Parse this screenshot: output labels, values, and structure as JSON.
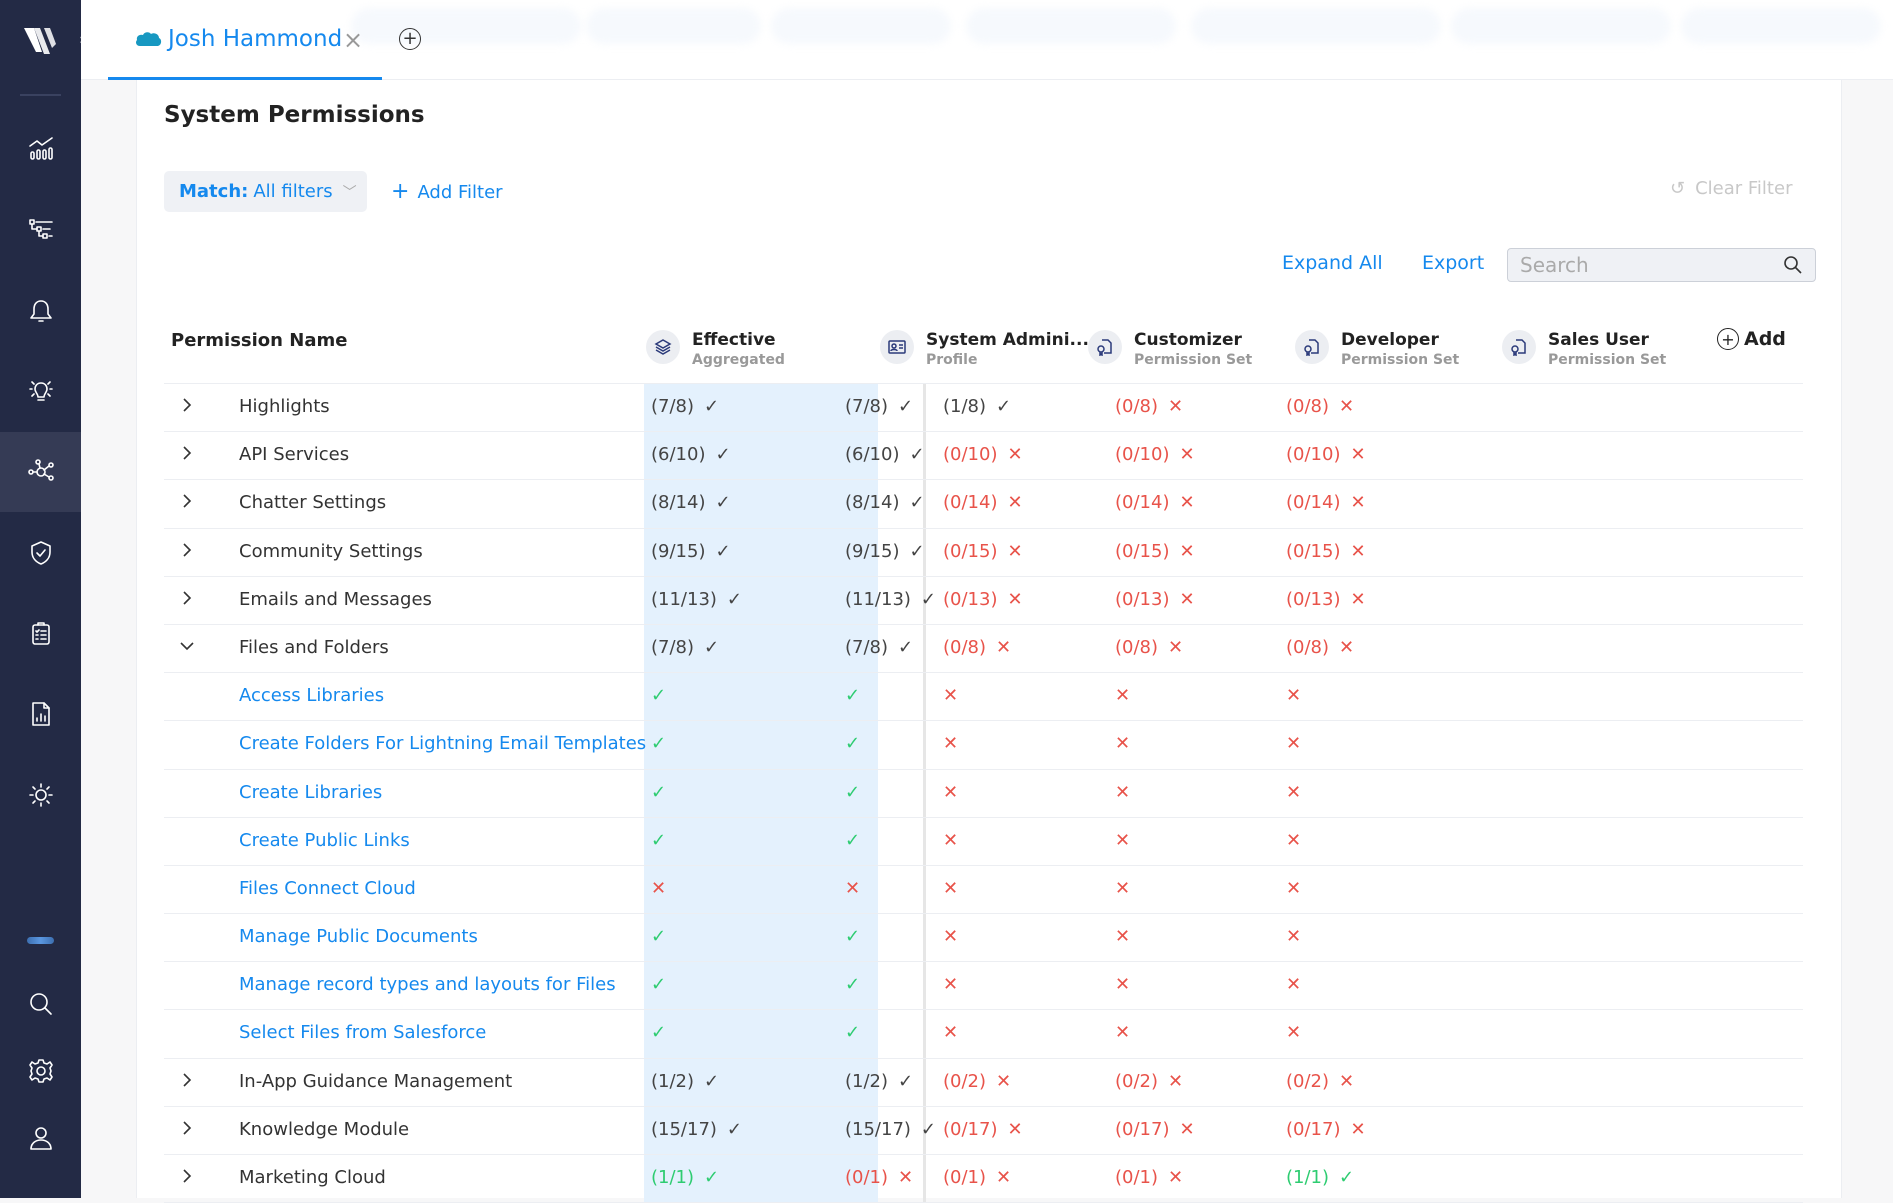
{
  "sidebar": {
    "logo": "logo-icon",
    "items": [
      {
        "name": "analytics",
        "icon": "chart-icon",
        "active": false
      },
      {
        "name": "hierarchy",
        "icon": "hierarchy-icon",
        "active": false
      },
      {
        "name": "alerts",
        "icon": "bell-icon",
        "active": false
      },
      {
        "name": "insights",
        "icon": "lightbulb-icon",
        "active": false
      },
      {
        "name": "connections",
        "icon": "network-icon",
        "active": true
      },
      {
        "name": "security",
        "icon": "shield-check-icon",
        "active": false
      },
      {
        "name": "tasks",
        "icon": "clipboard-icon",
        "active": false
      },
      {
        "name": "reports",
        "icon": "report-icon",
        "active": false
      },
      {
        "name": "theme",
        "icon": "sun-icon",
        "active": false
      }
    ],
    "bottom": [
      {
        "name": "search",
        "icon": "search-icon"
      },
      {
        "name": "settings",
        "icon": "gear-icon"
      },
      {
        "name": "profile",
        "icon": "user-icon"
      }
    ]
  },
  "tabs": [
    {
      "label": "Josh Hammond",
      "icon": "salesforce-cloud-icon",
      "active": true
    }
  ],
  "page": {
    "title": "System Permissions",
    "match_label": "Match:",
    "match_value": "All filters",
    "add_filter": "Add Filter",
    "clear_filter": "Clear Filter",
    "expand_all": "Expand All",
    "export": "Export",
    "search_placeholder": "Search",
    "search_value": ""
  },
  "table": {
    "name_header": "Permission Name",
    "add_label": "Add",
    "columns": [
      {
        "title": "Effective",
        "subtitle": "Aggregated",
        "icon": "layers-icon"
      },
      {
        "title": "System Admini...",
        "subtitle": "Profile",
        "icon": "id-card-icon"
      },
      {
        "title": "Customizer",
        "subtitle": "Permission Set",
        "icon": "certificate-icon"
      },
      {
        "title": "Developer",
        "subtitle": "Permission Set",
        "icon": "certificate-icon"
      },
      {
        "title": "Sales User",
        "subtitle": "Permission Set",
        "icon": "certificate-icon"
      }
    ],
    "rows": [
      {
        "name": "Highlights",
        "type": "group",
        "expanded": false,
        "cells": [
          [
            "(7/8)",
            "check",
            "dark"
          ],
          [
            "(7/8)",
            "check",
            "dark"
          ],
          [
            "(1/8)",
            "check",
            "dark"
          ],
          [
            "(0/8)",
            "cross",
            "red"
          ],
          [
            "(0/8)",
            "cross",
            "red"
          ]
        ]
      },
      {
        "name": "API Services",
        "type": "group",
        "expanded": false,
        "cells": [
          [
            "(6/10)",
            "check",
            "dark"
          ],
          [
            "(6/10)",
            "check",
            "dark"
          ],
          [
            "(0/10)",
            "cross",
            "red"
          ],
          [
            "(0/10)",
            "cross",
            "red"
          ],
          [
            "(0/10)",
            "cross",
            "red"
          ]
        ]
      },
      {
        "name": "Chatter Settings",
        "type": "group",
        "expanded": false,
        "cells": [
          [
            "(8/14)",
            "check",
            "dark"
          ],
          [
            "(8/14)",
            "check",
            "dark"
          ],
          [
            "(0/14)",
            "cross",
            "red"
          ],
          [
            "(0/14)",
            "cross",
            "red"
          ],
          [
            "(0/14)",
            "cross",
            "red"
          ]
        ]
      },
      {
        "name": "Community Settings",
        "type": "group",
        "expanded": false,
        "cells": [
          [
            "(9/15)",
            "check",
            "dark"
          ],
          [
            "(9/15)",
            "check",
            "dark"
          ],
          [
            "(0/15)",
            "cross",
            "red"
          ],
          [
            "(0/15)",
            "cross",
            "red"
          ],
          [
            "(0/15)",
            "cross",
            "red"
          ]
        ]
      },
      {
        "name": "Emails and Messages",
        "type": "group",
        "expanded": false,
        "cells": [
          [
            "(11/13)",
            "check",
            "dark"
          ],
          [
            "(11/13)",
            "check",
            "dark"
          ],
          [
            "(0/13)",
            "cross",
            "red"
          ],
          [
            "(0/13)",
            "cross",
            "red"
          ],
          [
            "(0/13)",
            "cross",
            "red"
          ]
        ]
      },
      {
        "name": "Files and Folders",
        "type": "group",
        "expanded": true,
        "cells": [
          [
            "(7/8)",
            "check",
            "dark"
          ],
          [
            "(7/8)",
            "check",
            "dark"
          ],
          [
            "(0/8)",
            "cross",
            "red"
          ],
          [
            "(0/8)",
            "cross",
            "red"
          ],
          [
            "(0/8)",
            "cross",
            "red"
          ]
        ]
      },
      {
        "name": "Access Libraries",
        "type": "child",
        "cells": [
          [
            "",
            "check",
            "green"
          ],
          [
            "",
            "check",
            "green"
          ],
          [
            "",
            "cross",
            "red"
          ],
          [
            "",
            "cross",
            "red"
          ],
          [
            "",
            "cross",
            "red"
          ]
        ]
      },
      {
        "name": "Create Folders For Lightning Email Templates",
        "type": "child",
        "cells": [
          [
            "",
            "check",
            "green"
          ],
          [
            "",
            "check",
            "green"
          ],
          [
            "",
            "cross",
            "red"
          ],
          [
            "",
            "cross",
            "red"
          ],
          [
            "",
            "cross",
            "red"
          ]
        ]
      },
      {
        "name": "Create Libraries",
        "type": "child",
        "cells": [
          [
            "",
            "check",
            "green"
          ],
          [
            "",
            "check",
            "green"
          ],
          [
            "",
            "cross",
            "red"
          ],
          [
            "",
            "cross",
            "red"
          ],
          [
            "",
            "cross",
            "red"
          ]
        ]
      },
      {
        "name": "Create Public Links",
        "type": "child",
        "cells": [
          [
            "",
            "check",
            "green"
          ],
          [
            "",
            "check",
            "green"
          ],
          [
            "",
            "cross",
            "red"
          ],
          [
            "",
            "cross",
            "red"
          ],
          [
            "",
            "cross",
            "red"
          ]
        ]
      },
      {
        "name": "Files Connect Cloud",
        "type": "child",
        "cells": [
          [
            "",
            "cross",
            "red"
          ],
          [
            "",
            "cross",
            "red"
          ],
          [
            "",
            "cross",
            "red"
          ],
          [
            "",
            "cross",
            "red"
          ],
          [
            "",
            "cross",
            "red"
          ]
        ]
      },
      {
        "name": "Manage Public Documents",
        "type": "child",
        "cells": [
          [
            "",
            "check",
            "green"
          ],
          [
            "",
            "check",
            "green"
          ],
          [
            "",
            "cross",
            "red"
          ],
          [
            "",
            "cross",
            "red"
          ],
          [
            "",
            "cross",
            "red"
          ]
        ]
      },
      {
        "name": "Manage record types and layouts for Files",
        "type": "child",
        "cells": [
          [
            "",
            "check",
            "green"
          ],
          [
            "",
            "check",
            "green"
          ],
          [
            "",
            "cross",
            "red"
          ],
          [
            "",
            "cross",
            "red"
          ],
          [
            "",
            "cross",
            "red"
          ]
        ]
      },
      {
        "name": "Select Files from Salesforce",
        "type": "child",
        "cells": [
          [
            "",
            "check",
            "green"
          ],
          [
            "",
            "check",
            "green"
          ],
          [
            "",
            "cross",
            "red"
          ],
          [
            "",
            "cross",
            "red"
          ],
          [
            "",
            "cross",
            "red"
          ]
        ]
      },
      {
        "name": "In-App Guidance Management",
        "type": "group",
        "expanded": false,
        "cells": [
          [
            "(1/2)",
            "check",
            "dark"
          ],
          [
            "(1/2)",
            "check",
            "dark"
          ],
          [
            "(0/2)",
            "cross",
            "red"
          ],
          [
            "(0/2)",
            "cross",
            "red"
          ],
          [
            "(0/2)",
            "cross",
            "red"
          ]
        ]
      },
      {
        "name": "Knowledge Module",
        "type": "group",
        "expanded": false,
        "cells": [
          [
            "(15/17)",
            "check",
            "dark"
          ],
          [
            "(15/17)",
            "check",
            "dark"
          ],
          [
            "(0/17)",
            "cross",
            "red"
          ],
          [
            "(0/17)",
            "cross",
            "red"
          ],
          [
            "(0/17)",
            "cross",
            "red"
          ]
        ]
      },
      {
        "name": "Marketing Cloud",
        "type": "group",
        "expanded": false,
        "cells": [
          [
            "(1/1)",
            "check",
            "green"
          ],
          [
            "(0/1)",
            "cross",
            "red"
          ],
          [
            "(0/1)",
            "cross",
            "red"
          ],
          [
            "(0/1)",
            "cross",
            "red"
          ],
          [
            "(1/1)",
            "check",
            "green"
          ]
        ]
      }
    ]
  },
  "colors": {
    "accent": "#1589ee",
    "sidebar": "#232a45",
    "effective_bg": "#e4f1fd",
    "deny": "#e8534a",
    "grant": "#2ecc71"
  }
}
